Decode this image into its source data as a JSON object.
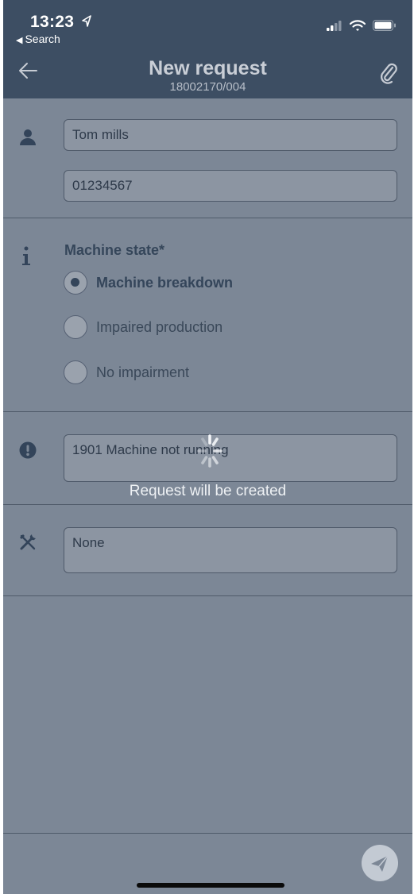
{
  "status_bar": {
    "time": "13:23",
    "back_app": "Search"
  },
  "nav": {
    "title": "New request",
    "subtitle": "18002170/004",
    "back_icon": "arrow-left-icon",
    "attach_icon": "paperclip-icon"
  },
  "contact": {
    "icon": "person-icon",
    "name_value": "Tom mills",
    "phone_value": "01234567"
  },
  "machine_state": {
    "icon": "info-icon",
    "label": "Machine state*",
    "options": [
      {
        "label": "Machine breakdown",
        "selected": true
      },
      {
        "label": "Impaired production",
        "selected": false
      },
      {
        "label": "No impairment",
        "selected": false
      }
    ]
  },
  "problem": {
    "icon": "exclamation-icon",
    "value": "1901 Machine not running"
  },
  "tools": {
    "icon": "tools-icon",
    "value": "None"
  },
  "loading": {
    "text": "Request will be created"
  },
  "footer": {
    "send_icon": "send-icon"
  },
  "colors": {
    "header_bg": "#3d4e63",
    "body_bg": "#7c8796",
    "accent": "#34455a"
  }
}
